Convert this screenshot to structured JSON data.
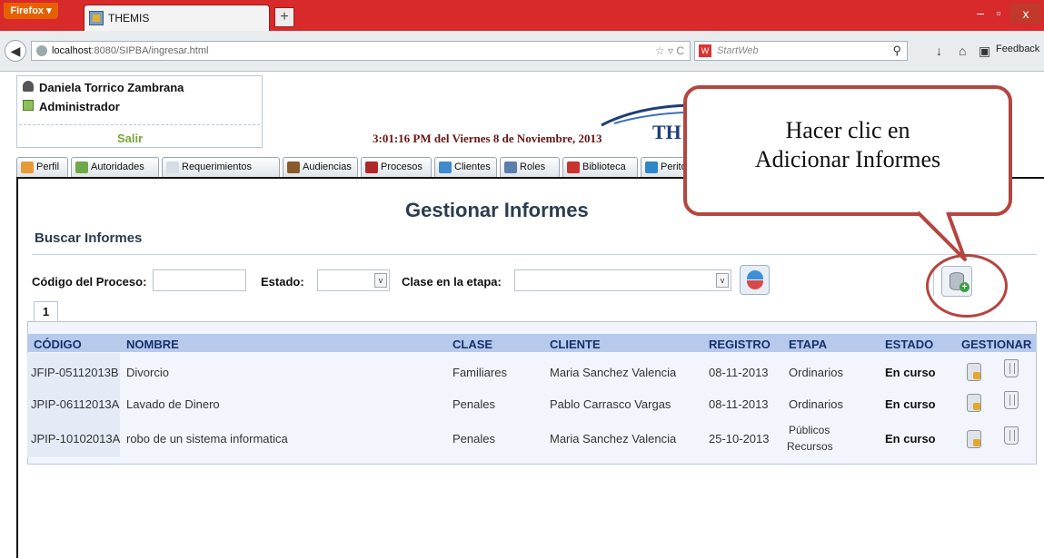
{
  "browser": {
    "menu_button": "Firefox ▾",
    "tab_title": "THEMIS",
    "new_tab": "+",
    "url_host": "localhost",
    "url_path": ":8080/SIPBA/ingresar.html",
    "search_placeholder": "StartWeb",
    "feedback": "Feedback"
  },
  "user": {
    "name": "Daniela Torrico Zambrana",
    "role": "Administrador",
    "logout": "Salir"
  },
  "header": {
    "datetime": "3:01:16 PM del Viernes 8 de Noviembre, 2013",
    "logo_text": "TH"
  },
  "menu_tabs": [
    "Perfil",
    "Autoridades",
    "Requerimientos",
    "Audiencias",
    "Procesos",
    "Clientes",
    "Roles",
    "Biblioteca",
    "Peritos"
  ],
  "page": {
    "title": "Gestionar Informes",
    "subtitle": "Buscar Informes"
  },
  "filters": {
    "codigo_label": "Código del Proceso:",
    "codigo_value": "",
    "estado_label": "Estado:",
    "estado_value": "",
    "clase_label": "Clase en la etapa:",
    "clase_value": ""
  },
  "pagination": {
    "current": "1"
  },
  "table": {
    "columns": [
      "CÓDIGO",
      "NOMBRE",
      "CLASE",
      "CLIENTE",
      "REGISTRO",
      "ETAPA",
      "ESTADO",
      "GESTIONAR"
    ],
    "rows": [
      {
        "codigo": "JFIP-05112013B",
        "nombre": "Divorcio",
        "clase": "Familiares",
        "cliente": "Maria Sanchez Valencia",
        "registro": "08-11-2013",
        "etapa": "Ordinarios",
        "etapa2": "",
        "estado": "En curso"
      },
      {
        "codigo": "JPIP-06112013A",
        "nombre": "Lavado de Dinero",
        "clase": "Penales",
        "cliente": "Pablo Carrasco Vargas",
        "registro": "08-11-2013",
        "etapa": "Ordinarios",
        "etapa2": "",
        "estado": "En curso"
      },
      {
        "codigo": "JPIP-10102013A",
        "nombre": "robo de un sistema informatica",
        "clase": "Penales",
        "cliente": "Maria Sanchez Valencia",
        "registro": "25-10-2013",
        "etapa": "Públicos",
        "etapa2": "Recursos",
        "estado": "En curso"
      }
    ]
  },
  "callout": {
    "line1": "Hacer clic en",
    "line2": "Adicionar Informes"
  }
}
